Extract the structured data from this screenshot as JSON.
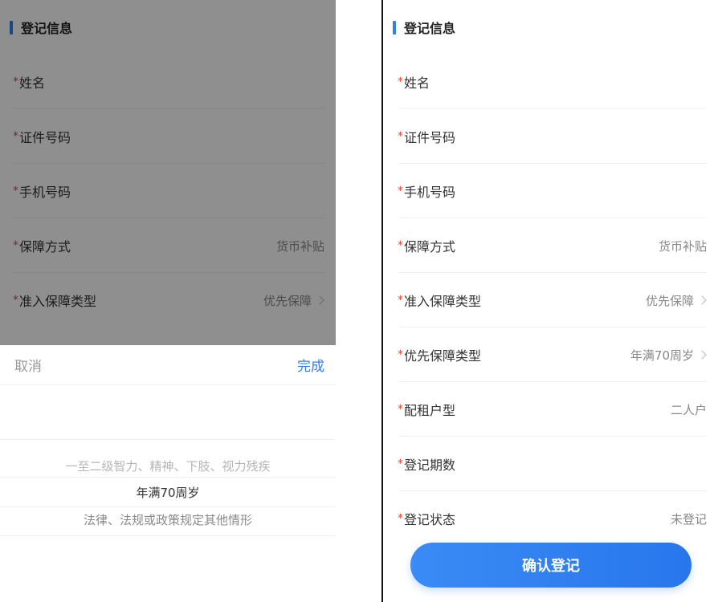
{
  "left": {
    "section_title": "登记信息",
    "fields": [
      {
        "label": "姓名",
        "value": ""
      },
      {
        "label": "证件号码",
        "value": ""
      },
      {
        "label": "手机号码",
        "value": ""
      },
      {
        "label": "保障方式",
        "value": "货币补贴"
      },
      {
        "label": "准入保障类型",
        "value": "优先保障"
      }
    ],
    "picker": {
      "cancel_label": "取消",
      "done_label": "完成",
      "options": [
        "一至二级智力、精神、下肢、视力残疾",
        "年满70周岁",
        "法律、法规或政策规定其他情形"
      ],
      "selected_index": 1
    }
  },
  "right": {
    "section_title": "登记信息",
    "fields": [
      {
        "label": "姓名",
        "value": ""
      },
      {
        "label": "证件号码",
        "value": ""
      },
      {
        "label": "手机号码",
        "value": ""
      },
      {
        "label": "保障方式",
        "value": "货币补贴"
      },
      {
        "label": "准入保障类型",
        "value": "优先保障"
      },
      {
        "label": "优先保障类型",
        "value": "年满70周岁"
      },
      {
        "label": "配租户型",
        "value": "二人户"
      },
      {
        "label": "登记期数",
        "value": ""
      },
      {
        "label": "登记状态",
        "value": "未登记"
      }
    ],
    "confirm_label": "确认登记"
  },
  "colors": {
    "accent": "#2f80ed",
    "required_star": "#e8442e",
    "overlay": "rgba(0,0,0,0.44)"
  },
  "icons": {
    "required": "asterisk",
    "chevron": "chevron-right-icon"
  }
}
